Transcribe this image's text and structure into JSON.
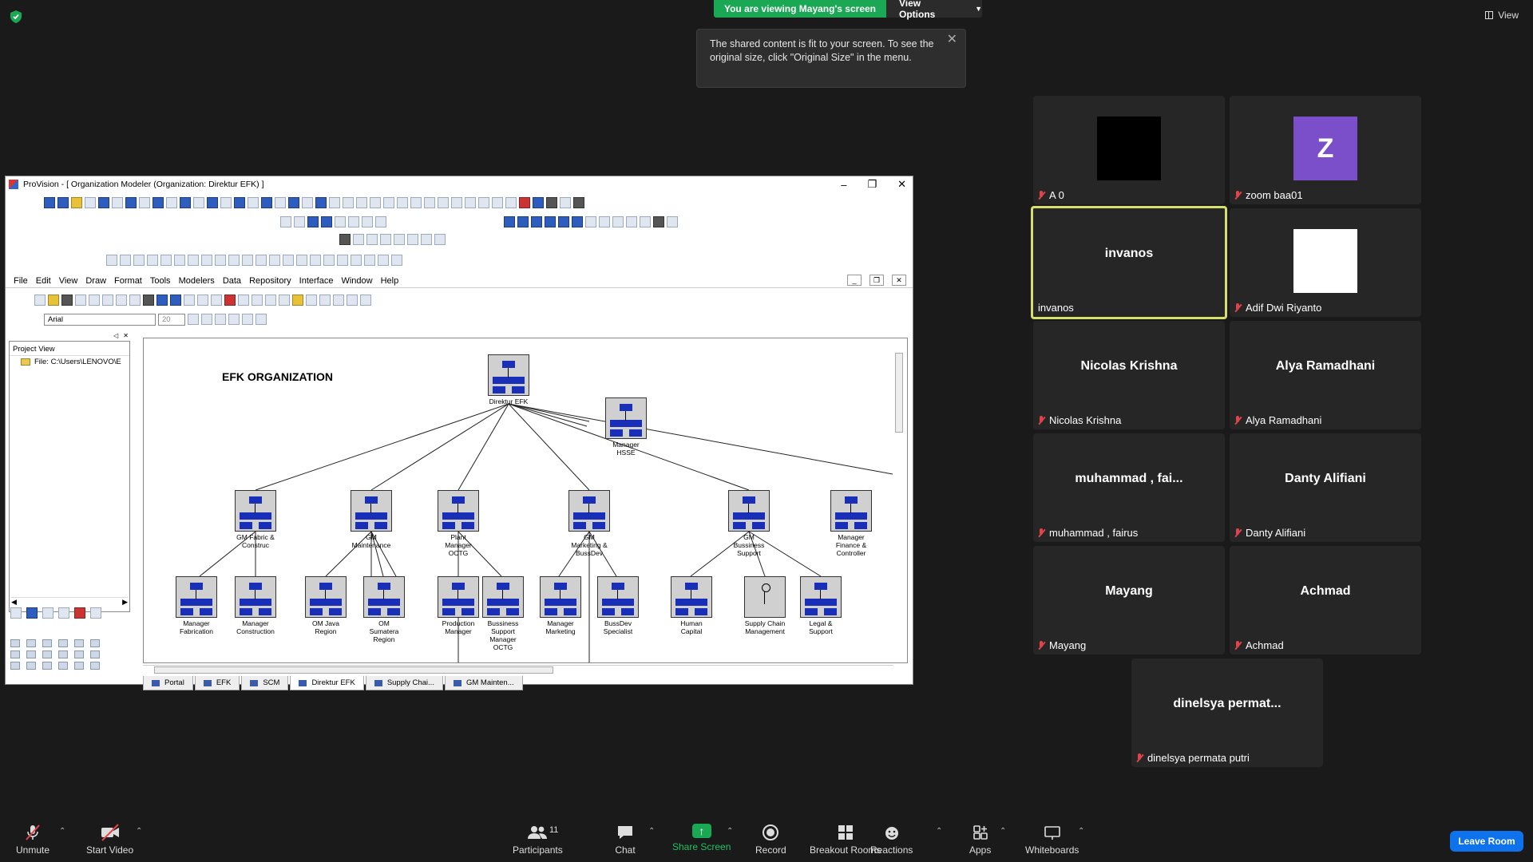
{
  "zoom": {
    "viewing_banner": "You are viewing Mayang's screen",
    "view_options": "View Options",
    "top_right_view": "View",
    "notice": "The shared content is fit to your screen. To see the original size, click \"Original Size\" in the menu."
  },
  "app": {
    "title": "ProVision - [ Organization Modeler (Organization: Direktur EFK) ]",
    "menu": [
      "File",
      "Edit",
      "View",
      "Draw",
      "Format",
      "Tools",
      "Modelers",
      "Data",
      "Repository",
      "Interface",
      "Window",
      "Help"
    ],
    "font_name": "Arial",
    "font_size": "20",
    "project_view_title": "Project View",
    "project_file": "File: C:\\Users\\LENOVO\\E",
    "canvas_title": "EFK ORGANIZATION",
    "nodes": {
      "direktur": "Direktur EFK",
      "hsse": "Manager HSSE",
      "gm_fabric": "GM Fabric & Construc",
      "gm_maint": "GM Maintenance",
      "plant": "Plant Manager OCTG",
      "gm_marketing": "GM Marketing & BussDev",
      "gm_business": "GM Bussiness Support",
      "mgr_finance": "Manager Finance & Controller",
      "mgr_fabrication": "Manager Fabrication",
      "mgr_construction": "Manager Construction",
      "om_java": "OM Java Region",
      "om_sumatera": "OM Sumatera Region",
      "production": "Production Manager",
      "business_support": "Bussiness Support Manager OCTG",
      "mgr_marketing": "Manager Marketing",
      "bussdev": "BussDev Specialist",
      "human_capital": "Human Capital",
      "supply_chain": "Supply Chain Management",
      "legal": "Legal & Support"
    },
    "tabs": [
      "Portal",
      "EFK",
      "SCM",
      "Direktur EFK",
      "Supply Chai...",
      "GM Mainten..."
    ]
  },
  "gallery": [
    {
      "name": "A 0",
      "display": "",
      "avatar_color": "#000000"
    },
    {
      "name": "zoom baa01",
      "display": "Z",
      "avatar_color": "#7b4fc9"
    },
    {
      "name": "invanos",
      "display": "invanos",
      "active": true
    },
    {
      "name": "Adif Dwi Riyanto",
      "display": "",
      "avatar_color": "#ffffff"
    },
    {
      "name": "Nicolas Krishna",
      "display": "Nicolas Krishna"
    },
    {
      "name": "Alya Ramadhani",
      "display": "Alya Ramadhani"
    },
    {
      "name": "muhammad , fairus",
      "display": "muhammad , fai..."
    },
    {
      "name": "Danty Alifiani",
      "display": "Danty Alifiani"
    },
    {
      "name": "Mayang",
      "display": "Mayang"
    },
    {
      "name": "Achmad",
      "display": "Achmad"
    },
    {
      "name": "dinelsya permata putri",
      "display": "dinelsya permat..."
    }
  ],
  "controls": {
    "unmute": "Unmute",
    "start_video": "Start Video",
    "participants": "Participants",
    "participants_count": "11",
    "chat": "Chat",
    "share_screen": "Share Screen",
    "record": "Record",
    "breakout": "Breakout Rooms",
    "reactions": "Reactions",
    "apps": "Apps",
    "whiteboards": "Whiteboards",
    "leave": "Leave Room"
  }
}
